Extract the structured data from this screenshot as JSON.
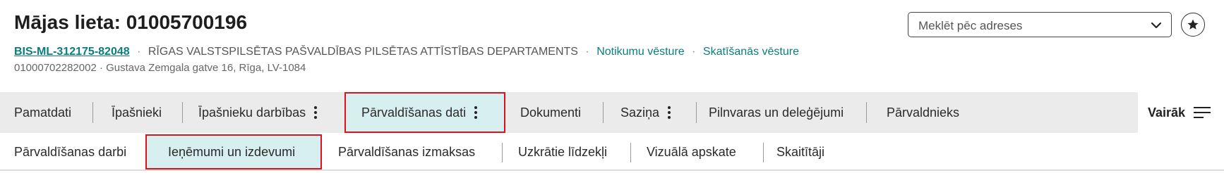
{
  "header": {
    "title": "Mājas lieta: 01005700196",
    "case_code": "BIS-ML-312175-82048",
    "separator": "·",
    "department": "RĪGAS VALSTSPILSĒTAS PAŠVALDĪBAS PILSĒTAS ATTĪSTĪBAS DEPARTAMENTS",
    "link_history": "Notikumu vēsture",
    "link_view_history": "Skatīšanās vēsture",
    "address_line": "01000702282002 · Gustava Zemgala gatve 16, Rīga, LV-1084"
  },
  "search": {
    "placeholder": "Meklēt pēc adreses",
    "icon": "chevron-down-icon"
  },
  "favorite": {
    "icon": "star-icon"
  },
  "main_tabs": [
    {
      "label": "Pamatdati",
      "menu": false
    },
    {
      "label": "Īpašnieki",
      "menu": false
    },
    {
      "label": "Īpašnieku darbības",
      "menu": true
    },
    {
      "label": "Pārvaldīšanas dati",
      "menu": true,
      "active": true
    },
    {
      "label": "Dokumenti",
      "menu": false
    },
    {
      "label": "Saziņa",
      "menu": true
    },
    {
      "label": "Pilnvaras un deleģējumi",
      "menu": false
    },
    {
      "label": "Pārvaldnieks",
      "menu": false
    }
  ],
  "more": {
    "label": "Vairāk",
    "icon": "menu-lines-icon"
  },
  "sub_tabs": [
    {
      "label": "Pārvaldīšanas darbi"
    },
    {
      "label": "Ieņēmumi un izdevumi",
      "active": true
    },
    {
      "label": "Pārvaldīšanas izmaksas"
    },
    {
      "label": "Uzkrātie līdzekļi"
    },
    {
      "label": "Vizuālā apskate"
    },
    {
      "label": "Skaitītāji"
    }
  ],
  "colors": {
    "accent": "#0a7d7d",
    "active_tab_bg": "#d7efef",
    "highlight_border": "#e0101a",
    "tab_bar_bg": "#ebebeb"
  }
}
